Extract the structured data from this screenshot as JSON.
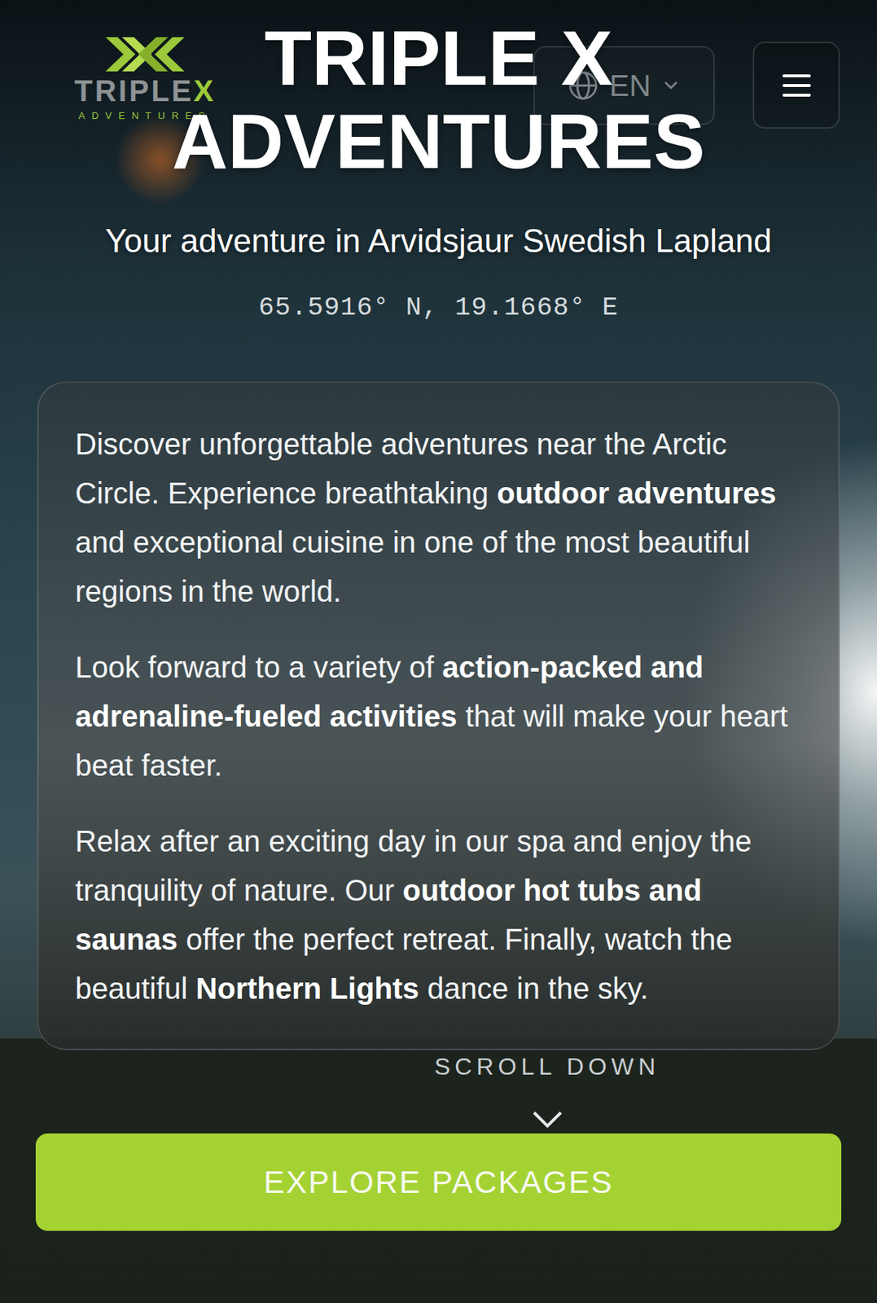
{
  "header": {
    "logo": {
      "brand": "TRIPLE",
      "mark": "X",
      "tagline": "ADVENTURES"
    },
    "language": {
      "label": "EN"
    }
  },
  "hero": {
    "title": "TRIPLE X ADVENTURES",
    "subtitle": "Your adventure in Arvidsjaur Swedish Lapland",
    "coordinates": "65.5916° N, 19.1668° E"
  },
  "intro": {
    "paragraphs": [
      [
        {
          "text": "Discover unforgettable adventures near the Arctic Circle. Experience breathtaking ",
          "bold": false
        },
        {
          "text": "outdoor adventures",
          "bold": true
        },
        {
          "text": " and exceptional cuisine in one of the most beautiful regions in the world.",
          "bold": false
        }
      ],
      [
        {
          "text": "Look forward to a variety of ",
          "bold": false
        },
        {
          "text": "action-packed and adrenaline-fueled activities",
          "bold": true
        },
        {
          "text": " that will make your heart beat faster.",
          "bold": false
        }
      ],
      [
        {
          "text": "Relax after an exciting day in our spa and enjoy the tranquility of nature. Our ",
          "bold": false
        },
        {
          "text": "outdoor hot tubs and saunas",
          "bold": true
        },
        {
          "text": " offer the perfect retreat. Finally, watch the beautiful ",
          "bold": false
        },
        {
          "text": "Northern Lights",
          "bold": true
        },
        {
          "text": " dance in the sky.",
          "bold": false
        }
      ]
    ]
  },
  "scroll_hint": "SCROLL DOWN",
  "cta": {
    "label": "EXPLORE PACKAGES"
  }
}
